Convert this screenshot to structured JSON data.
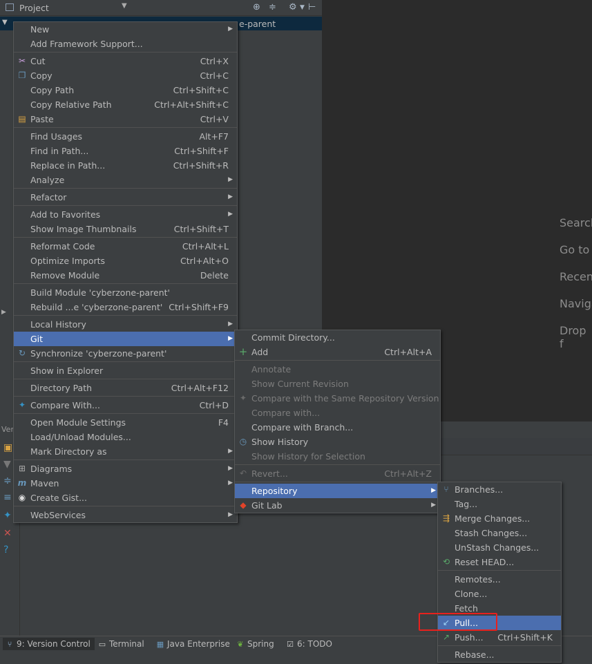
{
  "project_panel": {
    "title": "Project",
    "tree_row_text": "e-parent"
  },
  "editor_hints": [
    "Search",
    "Go to",
    "Recent",
    "Naviga",
    "Drop f"
  ],
  "bottom_panel": {
    "strip_label": "Ver"
  },
  "tool_tabs": [
    {
      "label": "9: Version Control",
      "icon": "git-icon"
    },
    {
      "label": "Terminal",
      "icon": "terminal-icon"
    },
    {
      "label": "Java Enterprise",
      "icon": "java-enterprise-icon"
    },
    {
      "label": "Spring",
      "icon": "spring-leaf-icon"
    },
    {
      "label": "6: TODO",
      "icon": "todo-icon"
    }
  ],
  "context_menu": {
    "items": [
      {
        "label": "New",
        "shortcut": "",
        "submenu": true
      },
      {
        "label": "Add Framework Support...",
        "shortcut": ""
      },
      {
        "label": "Cut",
        "shortcut": "Ctrl+X",
        "icon": "scissors-icon"
      },
      {
        "label": "Copy",
        "shortcut": "Ctrl+C",
        "icon": "copy-icon"
      },
      {
        "label": "Copy Path",
        "shortcut": "Ctrl+Shift+C"
      },
      {
        "label": "Copy Relative Path",
        "shortcut": "Ctrl+Alt+Shift+C"
      },
      {
        "label": "Paste",
        "shortcut": "Ctrl+V",
        "icon": "paste-icon"
      },
      {
        "label": "Find Usages",
        "shortcut": "Alt+F7"
      },
      {
        "label": "Find in Path...",
        "shortcut": "Ctrl+Shift+F"
      },
      {
        "label": "Replace in Path...",
        "shortcut": "Ctrl+Shift+R"
      },
      {
        "label": "Analyze",
        "shortcut": "",
        "submenu": true
      },
      {
        "label": "Refactor",
        "shortcut": "",
        "submenu": true
      },
      {
        "label": "Add to Favorites",
        "shortcut": "",
        "submenu": true
      },
      {
        "label": "Show Image Thumbnails",
        "shortcut": "Ctrl+Shift+T"
      },
      {
        "label": "Reformat Code",
        "shortcut": "Ctrl+Alt+L"
      },
      {
        "label": "Optimize Imports",
        "shortcut": "Ctrl+Alt+O"
      },
      {
        "label": "Remove Module",
        "shortcut": "Delete"
      },
      {
        "label": "Build Module 'cyberzone-parent'",
        "shortcut": ""
      },
      {
        "label": "Rebuild ...e 'cyberzone-parent'",
        "shortcut": "Ctrl+Shift+F9"
      },
      {
        "label": "Local History",
        "shortcut": "",
        "submenu": true
      },
      {
        "label": "Git",
        "shortcut": "",
        "submenu": true
      },
      {
        "label": "Synchronize 'cyberzone-parent'",
        "shortcut": "",
        "icon": "sync-icon"
      },
      {
        "label": "Show in Explorer",
        "shortcut": ""
      },
      {
        "label": "Directory Path",
        "shortcut": "Ctrl+Alt+F12"
      },
      {
        "label": "Compare With...",
        "shortcut": "Ctrl+D",
        "icon": "compare-icon"
      },
      {
        "label": "Open Module Settings",
        "shortcut": "F4"
      },
      {
        "label": "Load/Unload Modules...",
        "shortcut": ""
      },
      {
        "label": "Mark Directory as",
        "shortcut": "",
        "submenu": true
      },
      {
        "label": "Diagrams",
        "shortcut": "",
        "submenu": true,
        "icon": "diagram-icon"
      },
      {
        "label": "Maven",
        "shortcut": "",
        "submenu": true,
        "icon": "maven-icon"
      },
      {
        "label": "Create Gist...",
        "shortcut": "",
        "icon": "github-icon"
      },
      {
        "label": "WebServices",
        "shortcut": "",
        "submenu": true
      }
    ]
  },
  "git_menu": {
    "items": [
      {
        "label": "Commit Directory...",
        "shortcut": ""
      },
      {
        "label": "Add",
        "shortcut": "Ctrl+Alt+A",
        "icon": "plus-icon"
      },
      {
        "label": "Annotate",
        "shortcut": ""
      },
      {
        "label": "Show Current Revision",
        "shortcut": ""
      },
      {
        "label": "Compare with the Same Repository Version",
        "shortcut": "",
        "icon": "compare-icon"
      },
      {
        "label": "Compare with...",
        "shortcut": ""
      },
      {
        "label": "Compare with Branch...",
        "shortcut": ""
      },
      {
        "label": "Show History",
        "shortcut": "",
        "icon": "history-icon"
      },
      {
        "label": "Show History for Selection",
        "shortcut": ""
      },
      {
        "label": "Revert...",
        "shortcut": "Ctrl+Alt+Z",
        "icon": "revert-icon"
      },
      {
        "label": "Repository",
        "shortcut": "",
        "submenu": true
      },
      {
        "label": "Git Lab",
        "shortcut": "",
        "submenu": true,
        "icon": "gitlab-icon"
      }
    ]
  },
  "repository_menu": {
    "items": [
      {
        "label": "Branches...",
        "shortcut": "",
        "icon": "branch-icon"
      },
      {
        "label": "Tag...",
        "shortcut": ""
      },
      {
        "label": "Merge Changes...",
        "shortcut": "",
        "icon": "merge-icon"
      },
      {
        "label": "Stash Changes...",
        "shortcut": ""
      },
      {
        "label": "UnStash Changes...",
        "shortcut": ""
      },
      {
        "label": "Reset HEAD...",
        "shortcut": "",
        "icon": "reset-icon"
      },
      {
        "label": "Remotes...",
        "shortcut": ""
      },
      {
        "label": "Clone...",
        "shortcut": ""
      },
      {
        "label": "Fetch",
        "shortcut": ""
      },
      {
        "label": "Pull...",
        "shortcut": "",
        "icon": "pull-icon"
      },
      {
        "label": "Push...",
        "shortcut": "Ctrl+Shift+K",
        "icon": "push-icon"
      },
      {
        "label": "Rebase...",
        "shortcut": ""
      }
    ]
  }
}
